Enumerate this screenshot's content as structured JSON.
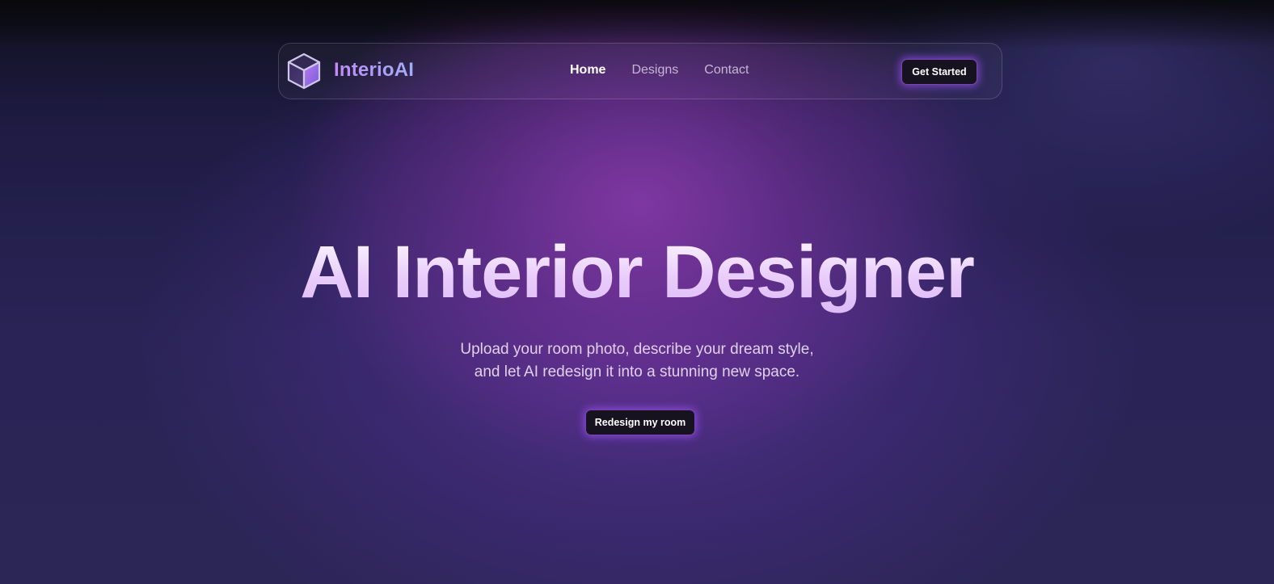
{
  "nav": {
    "brand": "InterioAI",
    "links": [
      {
        "label": "Home",
        "active": true
      },
      {
        "label": "Designs",
        "active": false
      },
      {
        "label": "Contact",
        "active": false
      }
    ],
    "cta_label": "Get Started"
  },
  "hero": {
    "title": "AI Interior Designer",
    "subtitle_line1": "Upload your room photo, describe your dream style,",
    "subtitle_line2": "and let AI redesign it into a stunning new space.",
    "cta_label": "Redesign my room"
  },
  "colors": {
    "accent": "#a05af0",
    "brand_gradient_start": "#c08af5",
    "brand_gradient_end": "#9eb0f5",
    "button_bg": "#17121f",
    "title": "#eed9ff"
  },
  "icons": {
    "logo": "cube-icon"
  }
}
